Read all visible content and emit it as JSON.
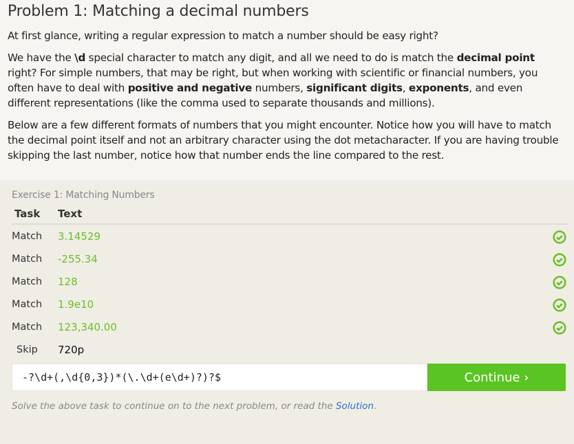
{
  "problem": {
    "title": "Problem 1: Matching a decimal numbers",
    "p1": "At first glance, writing a regular expression to match a number should be easy right?",
    "p2": [
      {
        "t": "We have the "
      },
      {
        "t": "\\d",
        "b": true
      },
      {
        "t": " special character to match any digit, and all we need to do is match the "
      },
      {
        "t": "decimal point",
        "b": true
      },
      {
        "t": " right? For simple numbers, that may be right, but when working with scientific or financial numbers, you often have to deal with "
      },
      {
        "t": "positive and negative",
        "b": true
      },
      {
        "t": " numbers, "
      },
      {
        "t": "significant digits",
        "b": true
      },
      {
        "t": ", "
      },
      {
        "t": "exponents",
        "b": true
      },
      {
        "t": ", and even different representations (like the comma used to separate thousands and millions)."
      }
    ],
    "p3": "Below are a few different formats of numbers that you might encounter. Notice how you will have to match the decimal point itself and not an arbitrary character using the dot metacharacter. If you are having trouble skipping the last number, notice how that number ends the line compared to the rest."
  },
  "exercise": {
    "title": "Exercise 1: Matching Numbers",
    "col_task": "Task",
    "col_text": "Text",
    "rows": [
      {
        "task": "Match",
        "text": "3.14529",
        "status": "check-circle-icon"
      },
      {
        "task": "Match",
        "text": "-255.34",
        "status": "check-circle-icon"
      },
      {
        "task": "Match",
        "text": "128",
        "status": "check-circle-icon"
      },
      {
        "task": "Match",
        "text": "1.9e10",
        "status": "check-circle-icon"
      },
      {
        "task": "Match",
        "text": "123,340.00",
        "status": "check-circle-icon"
      },
      {
        "task": "Skip",
        "text": "720p"
      }
    ],
    "input_value": "-?\\d+(,\\d{0,3})*(\\.\\d+(e\\d+)?)?$",
    "continue_label": "Continue ›",
    "footer_text": "Solve the above task to continue on to the next problem, or read the ",
    "footer_link": "Solution",
    "footer_end": "."
  },
  "colors": {
    "accent": "#5ac422",
    "match_text": "#6cbf2a",
    "link": "#2a6fd6"
  }
}
